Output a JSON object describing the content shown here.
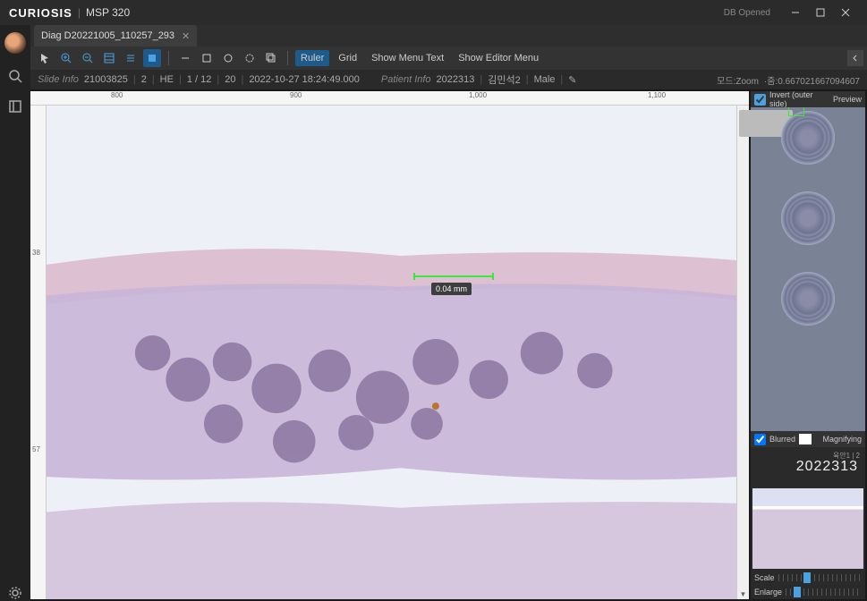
{
  "titlebar": {
    "brand": "CURIOSIS",
    "app": "MSP 320",
    "db_status": "DB Opened"
  },
  "tab": {
    "label": "Diag D20221005_110257_293"
  },
  "toolbar": {
    "ruler": "Ruler",
    "grid": "Grid",
    "show_menu_text": "Show Menu Text",
    "show_editor_menu": "Show Editor Menu"
  },
  "slideinfo": {
    "label": "Slide Info",
    "id": "21003825",
    "seq": "2",
    "stain": "HE",
    "page": "1 / 12",
    "zoom_level": "20",
    "timestamp": "2022-10-27 18:24:49.000"
  },
  "patientinfo": {
    "label": "Patient Info",
    "id": "2022313",
    "name": "김민석2",
    "sex": "Male"
  },
  "mode": {
    "label": "모드:Zoom",
    "zoom_value": "·줌:0.667021667094607"
  },
  "ruler": {
    "h": [
      "800",
      "900",
      "1,000",
      "1,100"
    ],
    "v": [
      "38",
      "57"
    ]
  },
  "measurement": {
    "value": "0.04 mm"
  },
  "rightpanel": {
    "invert": "Invert (outer side)",
    "preview": "Preview",
    "blurred": "Blurred",
    "magnifying": "Magnifying",
    "big_id": "2022313",
    "meta": "육안1   |   2",
    "scale": "Scale",
    "enlarge": "Enlarge"
  }
}
